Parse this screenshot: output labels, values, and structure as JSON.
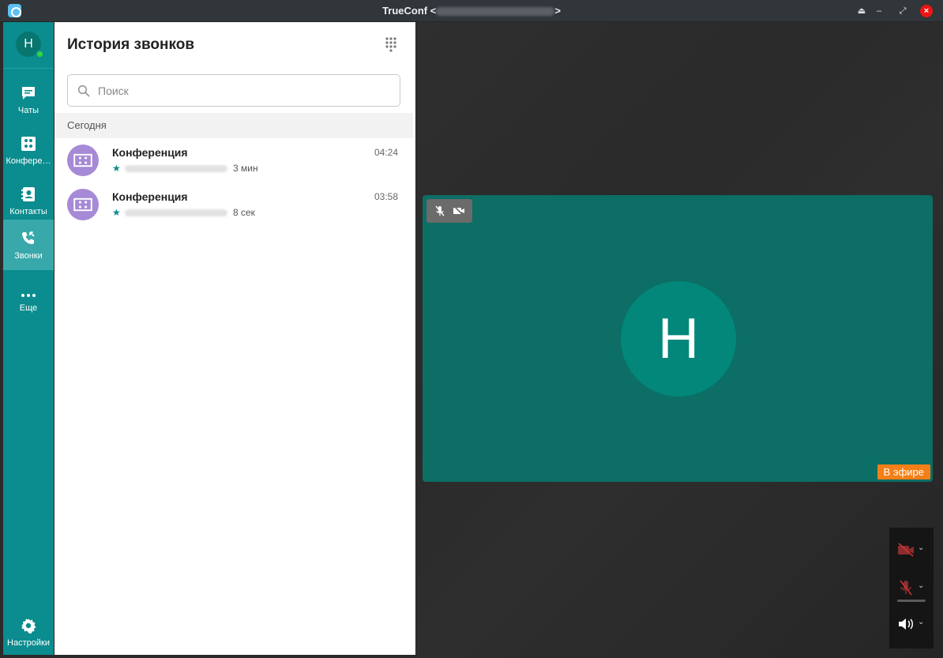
{
  "window": {
    "title_prefix": "TrueConf <",
    "title_suffix": ">",
    "controls": [
      "⏏",
      "–",
      "⤢",
      "×"
    ]
  },
  "user": {
    "initial": "H",
    "status_color": "#32d83a"
  },
  "sidebar": {
    "items": [
      {
        "label": "Чаты",
        "icon": "chat-icon",
        "active": false
      },
      {
        "label": "Конфере…",
        "icon": "conference-icon",
        "active": false
      },
      {
        "label": "Контакты",
        "icon": "contacts-icon",
        "active": false
      },
      {
        "label": "Звонки",
        "icon": "calls-icon",
        "active": true
      },
      {
        "label": "Еще",
        "icon": "more-icon",
        "active": false
      }
    ],
    "settings_label": "Настройки"
  },
  "history": {
    "title": "История звонков",
    "search_placeholder": "Поиск",
    "section": "Сегодня",
    "calls": [
      {
        "name": "Конференция",
        "time": "04:24",
        "duration": "3 мин"
      },
      {
        "name": "Конференция",
        "time": "03:58",
        "duration": "8 сек"
      }
    ]
  },
  "video": {
    "participant_initial": "H",
    "live_label": "В эфире"
  },
  "colors": {
    "accent": "#0b8c8e",
    "tile": "#0c6e64",
    "live": "#f57f17",
    "avatar_conf": "#a68ad6"
  }
}
